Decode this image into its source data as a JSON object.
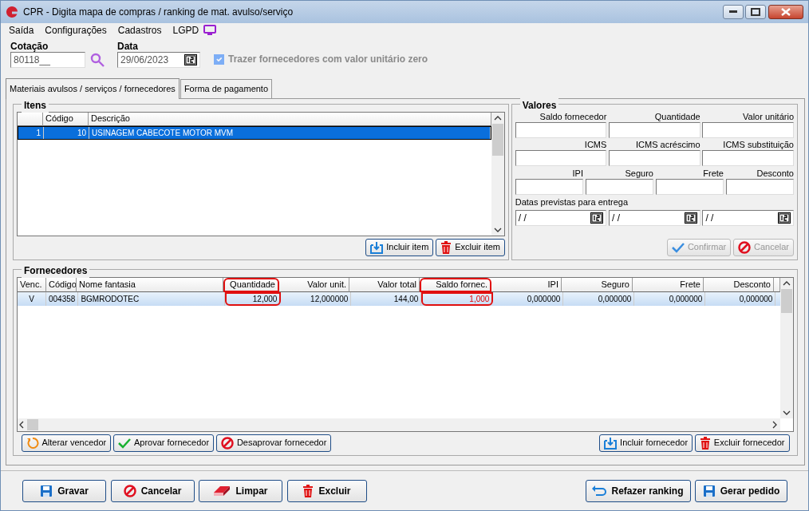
{
  "window": {
    "title": "CPR - Digita mapa de compras / ranking de mat. avulso/serviço"
  },
  "menu": [
    "Saída",
    "Configurações",
    "Cadastros",
    "LGPD"
  ],
  "cotacao": {
    "label": "Cotação",
    "value": "80118__"
  },
  "data": {
    "label": "Data",
    "value": "29/06/2023"
  },
  "option": {
    "label": "Trazer fornecedores com valor unitário zero",
    "checked": true,
    "disabled": true
  },
  "tabs": [
    {
      "label": "Materiais avulsos / serviços / fornecedores",
      "selected": true
    },
    {
      "label": "Forma de pagamento",
      "selected": false
    }
  ],
  "itens": {
    "title": "Itens",
    "columns": [
      "",
      "Código",
      "Descrição"
    ],
    "rows": [
      {
        "cells": [
          "1",
          "10",
          "USINAGEM CABECOTE MOTOR MVM"
        ],
        "selected": true
      }
    ],
    "buttons": [
      "Incluir item",
      "Excluir item"
    ]
  },
  "valores": {
    "title": "Valores",
    "fields": [
      [
        "Saldo fornecedor",
        "Quantidade",
        "Valor unitário"
      ],
      [
        "ICMS",
        "ICMS acréscimo",
        "ICMS substituição"
      ],
      [
        "IPI",
        "Seguro",
        "Frete",
        "Desconto"
      ]
    ],
    "dates_label": "Datas previstas para entrega",
    "dates": [
      "/ /",
      "/ /",
      "/ /"
    ],
    "buttons": [
      {
        "label": "Confirmar",
        "disabled": true
      },
      {
        "label": "Cancelar",
        "disabled": true
      }
    ]
  },
  "fornecedores": {
    "title": "Fornecedores",
    "columns": [
      {
        "label": "Venc.",
        "circled": false
      },
      {
        "label": "Código",
        "circled": false
      },
      {
        "label": "Nome fantasia",
        "circled": false
      },
      {
        "label": "Quantidade",
        "circled": true
      },
      {
        "label": "Valor unit.",
        "circled": false
      },
      {
        "label": "Valor total",
        "circled": false
      },
      {
        "label": "Saldo fornec.",
        "circled": true
      },
      {
        "label": "IPI",
        "circled": false
      },
      {
        "label": "Seguro",
        "circled": false
      },
      {
        "label": "Frete",
        "circled": false
      },
      {
        "label": "Desconto",
        "circled": false
      }
    ],
    "rows": [
      {
        "selected": true,
        "cells": [
          {
            "text": "V",
            "warning": false
          },
          {
            "text": "004358",
            "warning": false
          },
          {
            "text": "BGMRODOTEC",
            "warning": false
          },
          {
            "text": "12,000",
            "warning": false
          },
          {
            "text": "12,000000",
            "warning": false
          },
          {
            "text": "144,00",
            "warning": false
          },
          {
            "text": "1,000",
            "warning": true
          },
          {
            "text": "0,000000",
            "warning": false
          },
          {
            "text": "0,000000",
            "warning": false
          },
          {
            "text": "0,000000",
            "warning": false
          },
          {
            "text": "0,000000",
            "warning": false
          }
        ]
      }
    ],
    "buttons_left": [
      "Alterar vencedor",
      "Aprovar fornecedor",
      "Desaprovar fornecedor"
    ],
    "buttons_right": [
      "Incluir fornecedor",
      "Excluir fornecedor"
    ]
  },
  "footer_left": [
    "Gravar",
    "Cancelar",
    "Limpar",
    "Excluir"
  ],
  "footer_right": [
    "Refazer ranking",
    "Gerar pedido"
  ]
}
